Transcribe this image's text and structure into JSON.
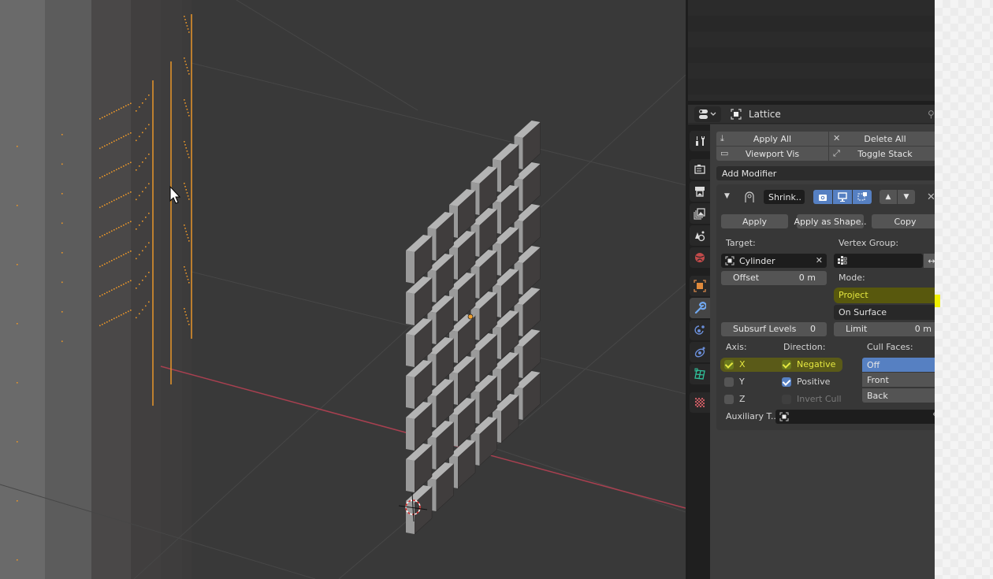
{
  "app": "Blender",
  "properties": {
    "context_name": "Lattice",
    "stack_buttons": {
      "apply_all": "Apply All",
      "delete_all": "Delete All",
      "viewport_vis": "Viewport Vis",
      "toggle_stack": "Toggle Stack"
    },
    "add_modifier": "Add Modifier",
    "tabs": [
      {
        "name": "tool",
        "icon": "tool-icon",
        "active": false
      },
      {
        "name": "render",
        "icon": "render-icon",
        "active": false
      },
      {
        "name": "output",
        "icon": "output-icon",
        "active": false
      },
      {
        "name": "view-layer",
        "icon": "view-layer-icon",
        "active": false
      },
      {
        "name": "scene",
        "icon": "scene-icon",
        "active": false
      },
      {
        "name": "world",
        "icon": "world-icon",
        "active": false
      },
      {
        "name": "object",
        "icon": "object-icon",
        "active": false
      },
      {
        "name": "modifiers",
        "icon": "wrench-icon",
        "active": true
      },
      {
        "name": "particles",
        "icon": "particles-icon",
        "active": false
      },
      {
        "name": "physics",
        "icon": "physics-icon",
        "active": false
      },
      {
        "name": "object-data",
        "icon": "lattice-data-icon",
        "active": false
      },
      {
        "name": "texture",
        "icon": "texture-icon",
        "active": false
      }
    ],
    "modifier": {
      "name": "Shrink..",
      "type_icon": "shrinkwrap-icon",
      "apply": "Apply",
      "apply_as_shape": "Apply as Shape..",
      "copy": "Copy",
      "target_label": "Target:",
      "target_value": "Cylinder",
      "vertex_group_label": "Vertex Group:",
      "vertex_group_value": "",
      "offset_label": "Offset",
      "offset_value": "0 m",
      "mode_label": "Mode:",
      "wrap_method": "Project",
      "snap_mode": "On Surface",
      "subsurf_label": "Subsurf Levels",
      "subsurf_value": "0",
      "limit_label": "Limit",
      "limit_value": "0 m",
      "axis_label": "Axis:",
      "direction_label": "Direction:",
      "cull_label": "Cull Faces:",
      "axes": [
        {
          "label": "X",
          "checked": true
        },
        {
          "label": "Y",
          "checked": false
        },
        {
          "label": "Z",
          "checked": false
        }
      ],
      "directions": [
        {
          "label": "Negative",
          "checked": true
        },
        {
          "label": "Positive",
          "checked": true
        },
        {
          "label": "Invert Cull",
          "checked": false,
          "disabled": true
        }
      ],
      "cull_options": [
        "Off",
        "Front",
        "Back"
      ],
      "cull_selected": "Off",
      "auxiliary_label": "Auxiliary T..",
      "auxiliary_value": ""
    }
  },
  "colors": {
    "accent_blue": "#5680c2",
    "selection_orange": "#f0a030",
    "x_axis_red": "#b04050",
    "highlight_yellow": "#e5e840"
  }
}
